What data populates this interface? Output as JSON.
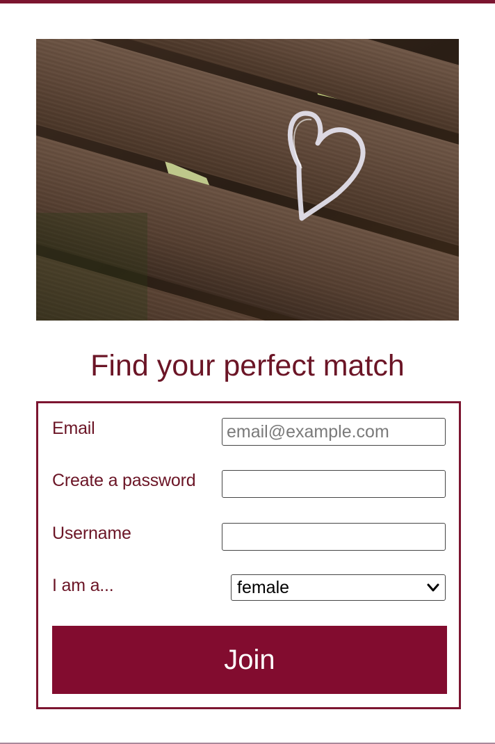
{
  "hero": {
    "image": "wooden-bench-chalk-heart-photo"
  },
  "headline": "Find your perfect match",
  "form": {
    "email": {
      "label": "Email",
      "placeholder": "email@example.com",
      "value": ""
    },
    "password": {
      "label": "Create a password",
      "value": ""
    },
    "username": {
      "label": "Username",
      "value": ""
    },
    "gender": {
      "label": "I am a...",
      "selected": "female"
    },
    "join_label": "Join"
  },
  "colors": {
    "brand": "#7c1530",
    "button": "#820c2f",
    "text": "#6b1526"
  },
  "icons": {
    "select_chevron": "chevron-down-icon"
  }
}
